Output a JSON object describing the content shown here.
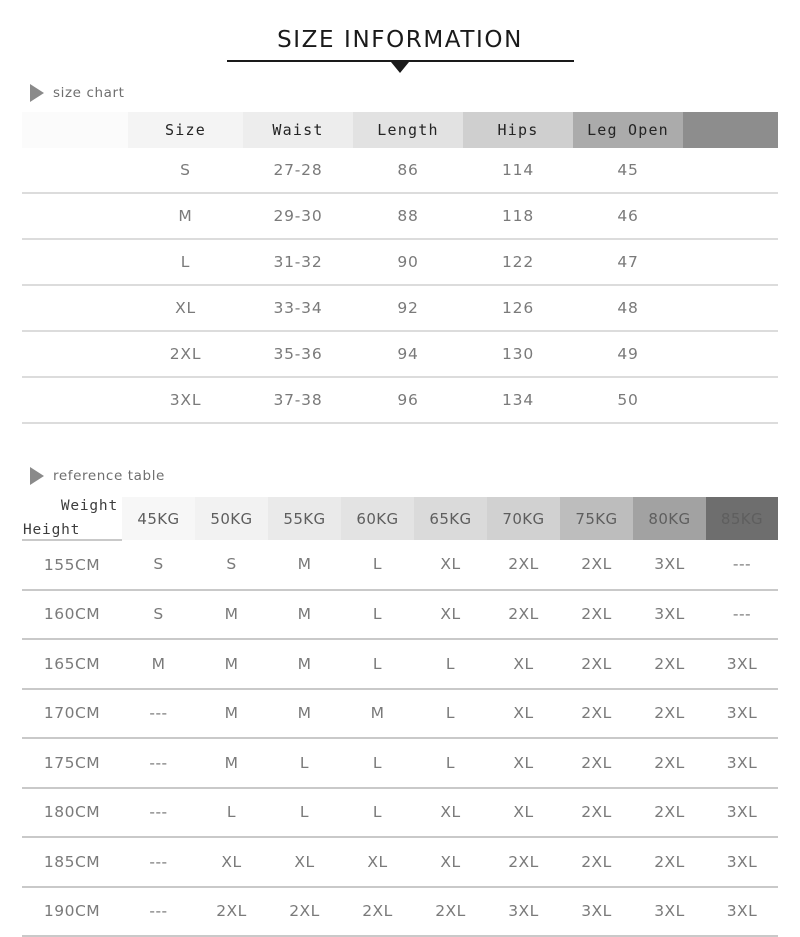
{
  "header": {
    "title": "SIZE INFORMATION",
    "arrow_icon": "triangle-down-icon",
    "rule_color": "#1a1a1a"
  },
  "sections": [
    {
      "key": "size_chart",
      "label": "size chart",
      "bullet_icon": "triangle-right-icon"
    },
    {
      "key": "reference_table",
      "label": "reference table",
      "bullet_icon": "triangle-right-icon"
    }
  ],
  "size_chart": {
    "columns": [
      "",
      "Size",
      "Waist",
      "Length",
      "Hips",
      "Leg Open",
      ""
    ],
    "header_colors": [
      "#fbfbfb",
      "#f4f4f4",
      "#ededed",
      "#e2e2e2",
      "#cfcfcf",
      "#ababab",
      "#8d8d8d"
    ],
    "rows": [
      {
        "size": "S",
        "waist": "27-28",
        "length": "86",
        "hips": "114",
        "leg_open": "45"
      },
      {
        "size": "M",
        "waist": "29-30",
        "length": "88",
        "hips": "118",
        "leg_open": "46"
      },
      {
        "size": "L",
        "waist": "31-32",
        "length": "90",
        "hips": "122",
        "leg_open": "47"
      },
      {
        "size": "XL",
        "waist": "33-34",
        "length": "92",
        "hips": "126",
        "leg_open": "48"
      },
      {
        "size": "2XL",
        "waist": "35-36",
        "length": "94",
        "hips": "130",
        "leg_open": "49"
      },
      {
        "size": "3XL",
        "waist": "37-38",
        "length": "96",
        "hips": "134",
        "leg_open": "50"
      }
    ]
  },
  "reference_table": {
    "corner": {
      "weight_label": "Weight",
      "height_label": "Height"
    },
    "weight_columns": [
      "45KG",
      "50KG",
      "55KG",
      "60KG",
      "65KG",
      "70KG",
      "75KG",
      "80KG",
      "85KG"
    ],
    "header_colors": [
      "#f7f7f7",
      "#f2f2f2",
      "#eaeaea",
      "#e3e3e3",
      "#dadada",
      "#d1d1d1",
      "#bdbdbd",
      "#a2a2a2",
      "#6e6e6e"
    ],
    "rows": [
      {
        "height": "155CM",
        "sizes": [
          "S",
          "S",
          "M",
          "L",
          "XL",
          "2XL",
          "2XL",
          "3XL",
          "---"
        ]
      },
      {
        "height": "160CM",
        "sizes": [
          "S",
          "M",
          "M",
          "L",
          "XL",
          "2XL",
          "2XL",
          "3XL",
          "---"
        ]
      },
      {
        "height": "165CM",
        "sizes": [
          "M",
          "M",
          "M",
          "L",
          "L",
          "XL",
          "2XL",
          "2XL",
          "3XL"
        ]
      },
      {
        "height": "170CM",
        "sizes": [
          "---",
          "M",
          "M",
          "M",
          "L",
          "XL",
          "2XL",
          "2XL",
          "3XL"
        ]
      },
      {
        "height": "175CM",
        "sizes": [
          "---",
          "M",
          "L",
          "L",
          "L",
          "XL",
          "2XL",
          "2XL",
          "3XL"
        ]
      },
      {
        "height": "180CM",
        "sizes": [
          "---",
          "L",
          "L",
          "L",
          "XL",
          "XL",
          "2XL",
          "2XL",
          "3XL"
        ]
      },
      {
        "height": "185CM",
        "sizes": [
          "---",
          "XL",
          "XL",
          "XL",
          "XL",
          "2XL",
          "2XL",
          "2XL",
          "3XL"
        ]
      },
      {
        "height": "190CM",
        "sizes": [
          "---",
          "2XL",
          "2XL",
          "2XL",
          "2XL",
          "3XL",
          "3XL",
          "3XL",
          "3XL"
        ]
      }
    ]
  }
}
